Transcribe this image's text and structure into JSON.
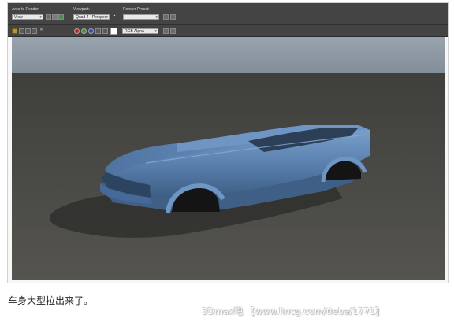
{
  "toolbar": {
    "area_to_render_label": "Area to Render:",
    "area_to_render_value": "View",
    "viewport_label": "Viewport:",
    "viewport_value": "Quad 4 - Perspec",
    "render_preset_label": "Render Preset:",
    "render_preset_value": "---------------------",
    "channel_value": "RGB Alpha"
  },
  "colors": {
    "panel": "#444444",
    "viewport_sky": "#8f9aa4",
    "viewport_ground": "#4c4c49",
    "car_body": "#5b82b0",
    "red_channel": "#d11f1f",
    "green_channel": "#2e9a2e",
    "blue_channel": "#2c44c6"
  },
  "icons": [
    "save-image-icon",
    "copy-image-icon",
    "clone-window-icon",
    "print-icon",
    "lock-icon",
    "render-settings-icon",
    "environment-icon",
    "pan-icon",
    "eyedropper-icon",
    "display-alpha-icon",
    "clear-icon",
    "red-channel-icon",
    "green-channel-icon",
    "blue-channel-icon",
    "monochrome-icon",
    "white-swatch-icon"
  ],
  "caption": "车身大型拉出来了。",
  "watermark": "3Dmax吧 【www.lincg.com/tieba/1771】"
}
